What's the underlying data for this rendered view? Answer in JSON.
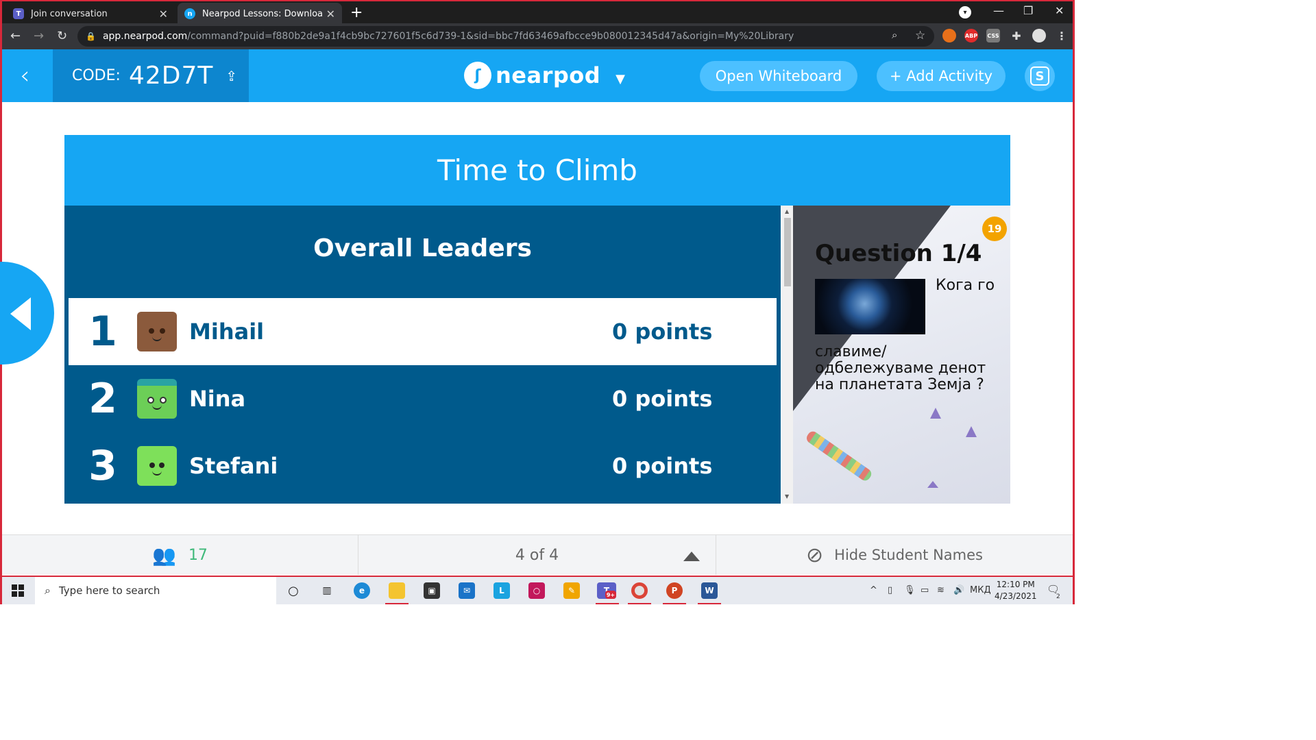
{
  "browser": {
    "tabs": [
      {
        "title": "Join conversation",
        "icon": "teams-icon"
      },
      {
        "title": "Nearpod Lessons: Download rea",
        "icon": "nearpod-icon"
      }
    ],
    "url_host": "app.nearpod.com",
    "url_path": "/command?puid=f880b2de9a1f4cb9bc727601f5c6d739-1&sid=bbc7fd63469afbcce9b080012345d47a&origin=My%20Library",
    "extensions": [
      "ABP",
      "CSS"
    ]
  },
  "header": {
    "code_label": "CODE:",
    "code_value": "42D7T",
    "logo_text": "nearpod",
    "open_whiteboard": "Open Whiteboard",
    "add_activity": "+ Add Activity",
    "user_initial": "S"
  },
  "activity": {
    "title": "Time to Climb",
    "leaders_title": "Overall Leaders",
    "leaders": [
      {
        "rank": "1",
        "name": "Mihail",
        "points": "0 points",
        "avatar_color": "#8b5a3c"
      },
      {
        "rank": "2",
        "name": "Nina",
        "points": "0 points",
        "avatar_color": "#6ccf57"
      },
      {
        "rank": "3",
        "name": "Stefani",
        "points": "0 points",
        "avatar_color": "#7ee05a"
      }
    ]
  },
  "question": {
    "timer": "19",
    "title": "Question 1/4",
    "text_part1": "Кога го",
    "text_part2": "славиме/ одбележуваме денот на планетата Земја ?"
  },
  "footer": {
    "students_count": "17",
    "page_indicator": "4 of 4",
    "hide_names": "Hide Student Names"
  },
  "taskbar": {
    "search_placeholder": "Type here to search",
    "teams_badge": "9+",
    "lang": "МКД",
    "time": "12:10 PM",
    "date": "4/23/2021",
    "notifications": "2"
  },
  "colors": {
    "nearpod_blue": "#16a6f3",
    "leaders_bg": "#005a8c",
    "students_green": "#3fb97a",
    "timer_orange": "#f3a300"
  }
}
